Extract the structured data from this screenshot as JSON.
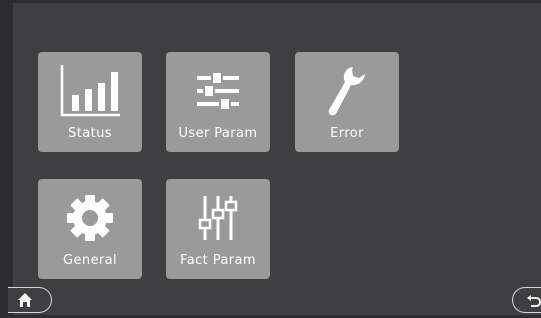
{
  "menu": {
    "tiles": [
      {
        "label": "Status",
        "icon": "bar-chart-icon"
      },
      {
        "label": "User Param",
        "icon": "sliders-icon"
      },
      {
        "label": "Error",
        "icon": "wrench-icon"
      },
      {
        "label": "General",
        "icon": "gear-icon"
      },
      {
        "label": "Fact Param",
        "icon": "vertical-sliders-icon"
      }
    ]
  },
  "nav": {
    "home_icon": "home-icon",
    "back_icon": "back-arrow-icon"
  },
  "colors": {
    "background": "#3f3f41",
    "tile": "#9a9a9a",
    "tile_text": "#ffffff"
  }
}
